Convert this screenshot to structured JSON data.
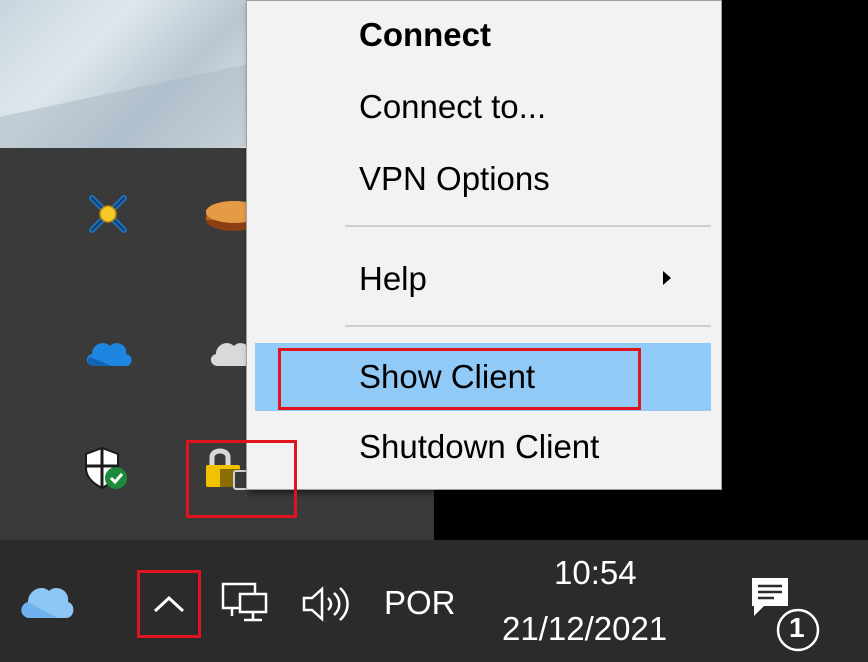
{
  "context_menu": {
    "items": [
      {
        "label": "Connect"
      },
      {
        "label": "Connect to..."
      },
      {
        "label": "VPN Options"
      },
      {
        "label": "Help"
      },
      {
        "label": "Show Client"
      },
      {
        "label": "Shutdown Client"
      }
    ]
  },
  "overflow_tray": {
    "icons": [
      "network-tool-icon",
      "disk-icon",
      "onedrive-icon",
      "onedrive-grey-icon",
      "windows-security-icon",
      "vpn-lock-icon"
    ]
  },
  "taskbar": {
    "language": "POR",
    "time": "10:54",
    "date": "21/12/2021",
    "notification_count": "1"
  },
  "colors": {
    "menu_highlight": "#91c9f7",
    "menu_background": "#f2f2f2",
    "taskbar_background": "#2b2b2b",
    "tray_background": "#3a3a3a",
    "annotation": "#e0141e"
  }
}
